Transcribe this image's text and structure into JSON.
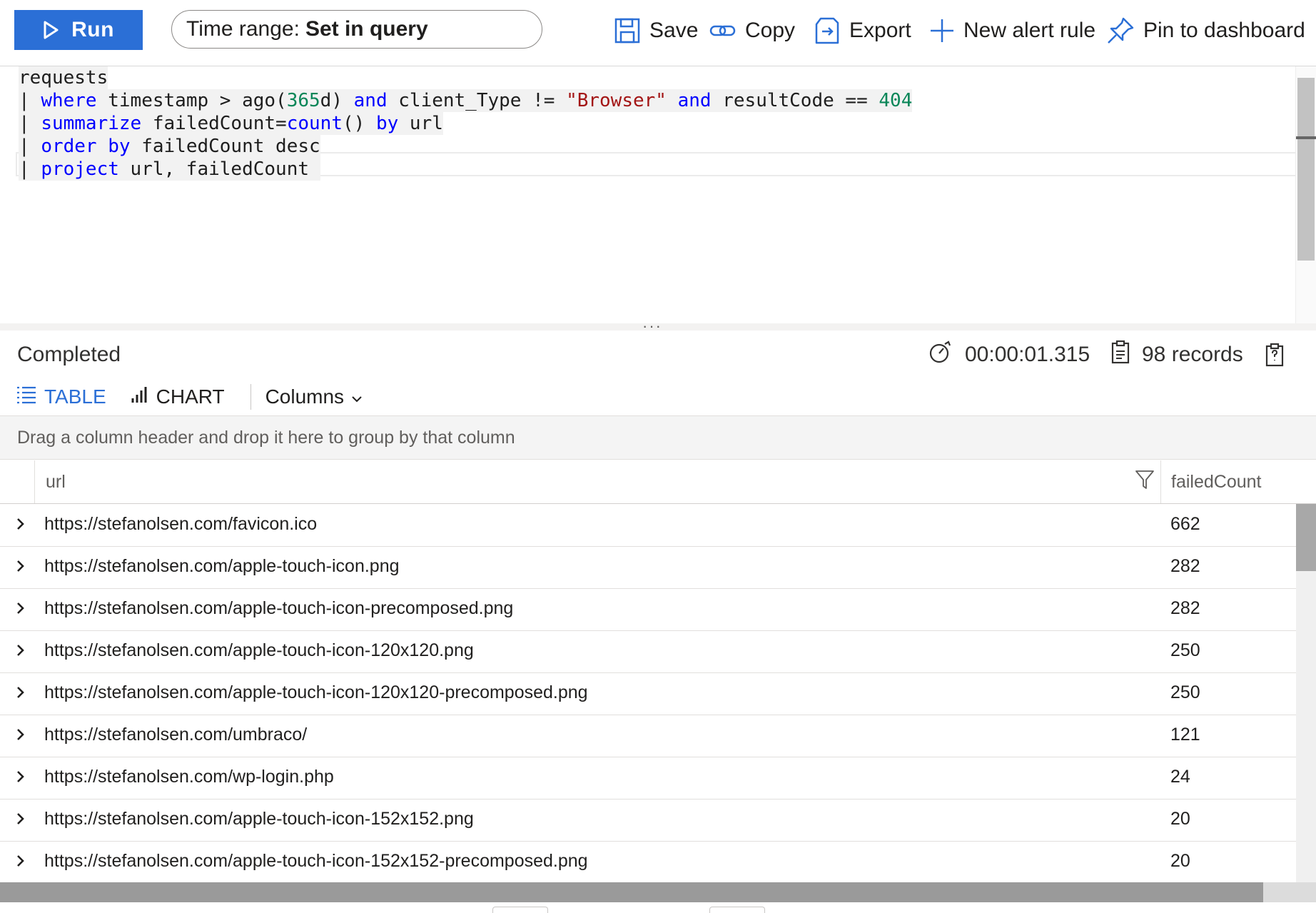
{
  "toolbar": {
    "run_label": "Run",
    "time_range_label": "Time range:",
    "time_range_value": "Set in query",
    "save_label": "Save",
    "copy_label": "Copy",
    "export_label": "Export",
    "new_alert_label": "New alert rule",
    "pin_label": "Pin to dashboard"
  },
  "query": {
    "lines": [
      "requests",
      "| where timestamp > ago(365d) and client_Type != \"Browser\" and resultCode == 404",
      "| summarize failedCount=count() by url",
      "| order by failedCount desc",
      "| project url, failedCount"
    ]
  },
  "results": {
    "status": "Completed",
    "duration": "00:00:01.315",
    "records": "98 records",
    "tabs": {
      "table": "TABLE",
      "chart": "CHART"
    },
    "columns_label": "Columns",
    "group_hint": "Drag a column header and drop it here to group by that column",
    "headers": {
      "url": "url",
      "failedCount": "failedCount"
    },
    "rows": [
      {
        "url": "https://stefanolsen.com/favicon.ico",
        "failedCount": "662"
      },
      {
        "url": "https://stefanolsen.com/apple-touch-icon.png",
        "failedCount": "282"
      },
      {
        "url": "https://stefanolsen.com/apple-touch-icon-precomposed.png",
        "failedCount": "282"
      },
      {
        "url": "https://stefanolsen.com/apple-touch-icon-120x120.png",
        "failedCount": "250"
      },
      {
        "url": "https://stefanolsen.com/apple-touch-icon-120x120-precomposed.png",
        "failedCount": "250"
      },
      {
        "url": "https://stefanolsen.com/umbraco/",
        "failedCount": "121"
      },
      {
        "url": "https://stefanolsen.com/wp-login.php",
        "failedCount": "24"
      },
      {
        "url": "https://stefanolsen.com/apple-touch-icon-152x152.png",
        "failedCount": "20"
      },
      {
        "url": "https://stefanolsen.com/apple-touch-icon-152x152-precomposed.png",
        "failedCount": "20"
      }
    ]
  },
  "colors": {
    "accent": "#2b6fd6",
    "keyword": "#0000ff",
    "string": "#a31515",
    "number": "#098658"
  },
  "icons": {
    "run": "play-icon",
    "save": "save-icon",
    "copy": "link-icon",
    "export": "export-icon",
    "new_alert": "plus-icon",
    "pin": "pin-icon",
    "duration": "stopwatch-icon",
    "records": "clipboard-icon",
    "table": "list-icon",
    "chart": "bar-chart-icon",
    "filter": "filter-icon",
    "expand": "chevron-right-icon"
  }
}
